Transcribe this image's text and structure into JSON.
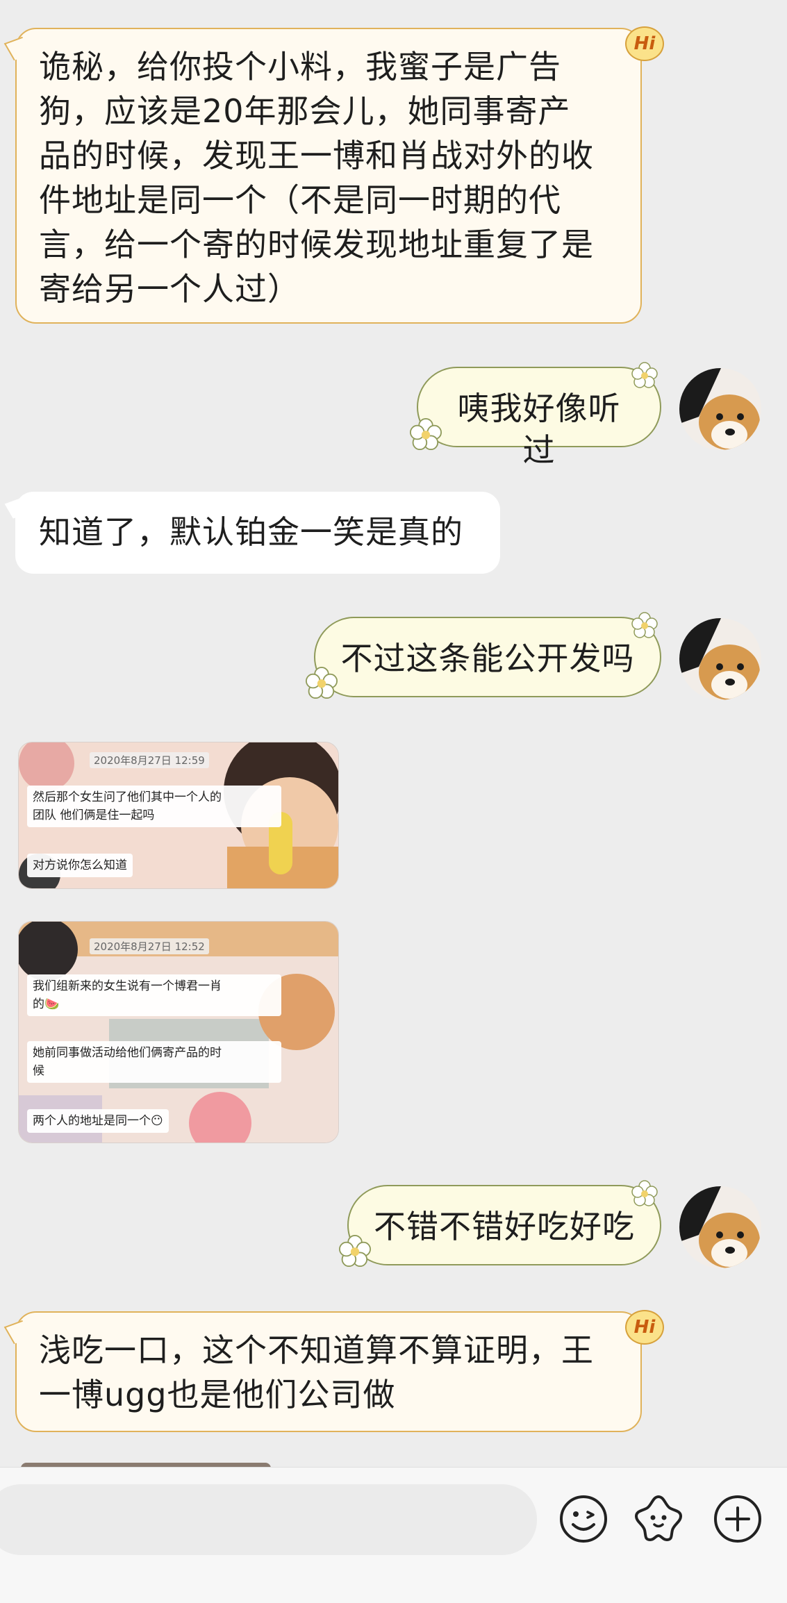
{
  "messages": [
    {
      "id": 1,
      "side": "left",
      "style": "gold",
      "badge": "Hi",
      "lines": [
        "诡秘，给你投个小料，我蜜子是广告",
        "狗，应该是20年那会儿，她同事寄产",
        "品的时候，发现王一博和肖战对外的收",
        "件地址是同一个（不是同一时期的代",
        "言，给一个寄的时候发现地址重复了是",
        "寄给另一个人过）"
      ]
    },
    {
      "id": 2,
      "side": "right",
      "text": "咦我好像听过"
    },
    {
      "id": 3,
      "side": "left",
      "style": "white",
      "text": "知道了，默认铂金一笑是真的"
    },
    {
      "id": 4,
      "side": "right",
      "text": "不过这条能公开发吗"
    },
    {
      "id": 5,
      "side": "left",
      "type": "image",
      "timestamp": "2020年8月27日 12:59",
      "bubbles": [
        "然后那个女生问了他们其中一个人的",
        "团队 他们俩是住一起吗",
        "对方说你怎么知道"
      ]
    },
    {
      "id": 6,
      "side": "left",
      "type": "image",
      "timestamp": "2020年8月27日 12:52",
      "bubbles": [
        "我们组新来的女生说有一个博君一肖",
        "的🍉",
        "她前同事做活动给他们俩寄产品的时",
        "候",
        "两个人的地址是同一个😶"
      ]
    },
    {
      "id": 7,
      "side": "right",
      "text": "不错不错好吃好吃"
    },
    {
      "id": 8,
      "side": "left",
      "style": "gold",
      "badge": "Hi",
      "lines": [
        "浅吃一口，这个不知道算不算证明，王",
        "一博ugg也是他们公司做"
      ]
    }
  ],
  "input_bar": {
    "input_placeholder": "",
    "icons": [
      "emoji-icon",
      "sticker-icon",
      "add-icon"
    ]
  },
  "colors": {
    "background": "#ededed",
    "gold_bubble_border": "#e0b25a",
    "right_bubble_border": "#8f9a5a",
    "right_bubble_fill": "#fdfbe3"
  }
}
